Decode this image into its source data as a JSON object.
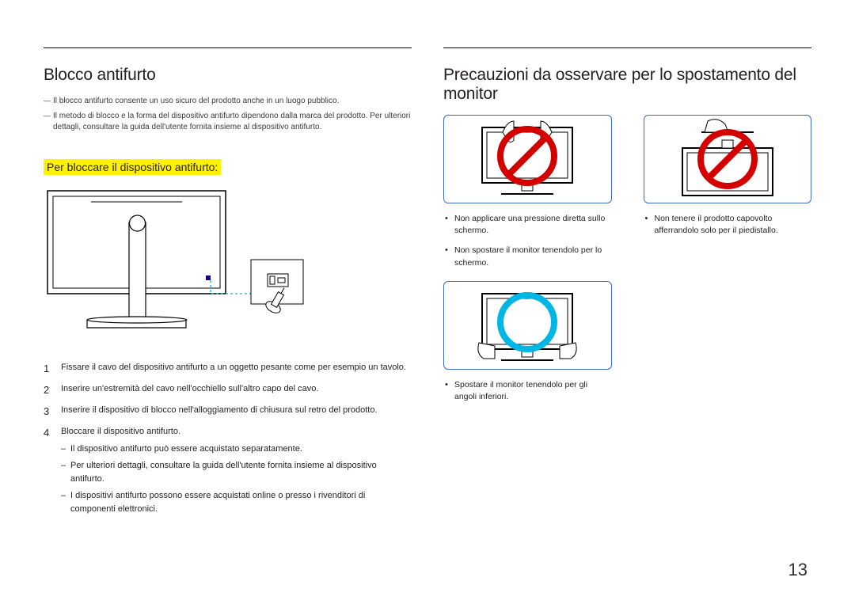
{
  "left": {
    "heading": "Blocco antifurto",
    "notes": [
      "Il blocco antifurto consente un uso sicuro del prodotto anche in un luogo pubblico.",
      "Il metodo di blocco e la forma del dispositivo antifurto dipendono dalla marca del prodotto. Per ulteriori dettagli, consultare la guida dell'utente fornita insieme al dispositivo antifurto."
    ],
    "subheading": "Per bloccare il dispositivo antifurto:",
    "steps": [
      {
        "text": "Fissare il cavo del dispositivo antifurto a un oggetto pesante come per esempio un tavolo."
      },
      {
        "text": "Inserire un'estremità del cavo nell'occhiello sull'altro capo del cavo."
      },
      {
        "text": "Inserire il dispositivo di blocco nell'alloggiamento di chiusura sul retro del prodotto."
      },
      {
        "text": "Bloccare il dispositivo antifurto.",
        "sub": [
          "Il dispositivo antifurto può essere acquistato separatamente.",
          "Per ulteriori dettagli, consultare la guida dell'utente fornita insieme al dispositivo antifurto.",
          "I dispositivi antifurto possono essere acquistati online o presso i rivenditori di componenti elettronici."
        ]
      }
    ]
  },
  "right": {
    "heading": "Precauzioni da osservare per lo spostamento del monitor",
    "items": [
      {
        "bullets": [
          "Non applicare una pressione diretta sullo schermo.",
          "Non spostare il monitor tenendolo per lo schermo."
        ]
      },
      {
        "bullets": [
          "Non tenere il prodotto capovolto afferrandolo solo per il piedistallo."
        ]
      },
      {
        "bullets": [
          "Spostare il monitor tenendolo per gli angoli inferiori."
        ]
      }
    ]
  },
  "page_number": "13"
}
